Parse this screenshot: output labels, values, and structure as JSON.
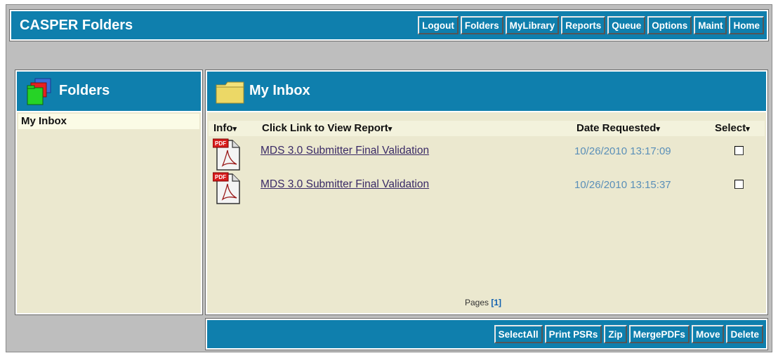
{
  "header": {
    "title": "CASPER Folders"
  },
  "nav": [
    "Logout",
    "Folders",
    "MyLibrary",
    "Reports",
    "Queue",
    "Options",
    "Maint",
    "Home"
  ],
  "sidebar": {
    "title": "Folders",
    "icon": "folders-icon",
    "items": [
      {
        "label": "My Inbox"
      }
    ]
  },
  "main": {
    "title": "My Inbox",
    "icon": "folder-icon",
    "columns": [
      "Info",
      "Click Link to View Report",
      "Date Requested",
      "Select"
    ],
    "rows": [
      {
        "icon": "pdf-icon",
        "report": "MDS 3.0 Submitter Final Validation",
        "date": "10/26/2010 13:17:09",
        "selected": false
      },
      {
        "icon": "pdf-icon",
        "report": "MDS 3.0 Submitter Final Validation",
        "date": "10/26/2010 13:15:37",
        "selected": false
      }
    ],
    "pages_label": "Pages",
    "pages_current": "[1]"
  },
  "actions": [
    "SelectAll",
    "Print PSRs",
    "Zip",
    "MergePDFs",
    "Move",
    "Delete"
  ],
  "colors": {
    "bar": "#0f7fad",
    "panel": "#ebe8cf",
    "frame": "#bebebe",
    "date": "#5a8fb8"
  }
}
